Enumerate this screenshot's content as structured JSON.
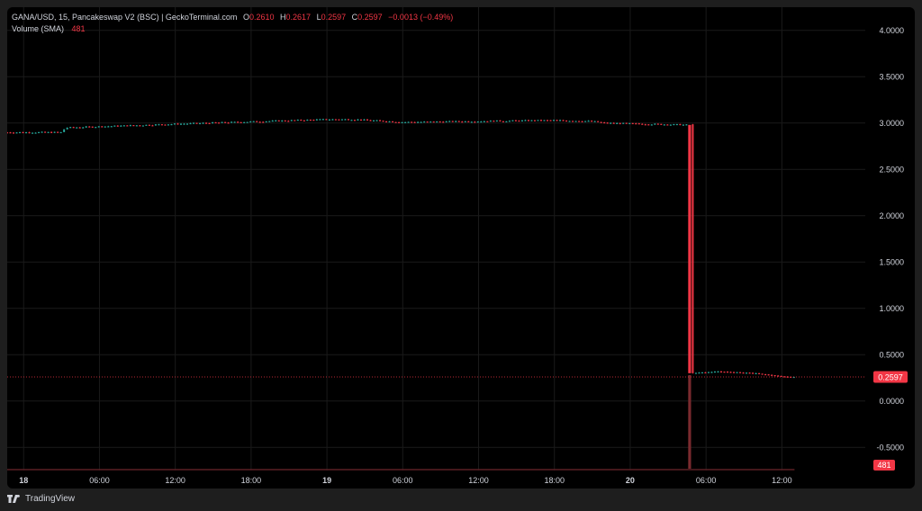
{
  "legend": {
    "title": "GANA/USD, 15, Pancakeswap V2 (BSC) | GeckoTerminal.com",
    "o_label": "O",
    "o_value": "0.2610",
    "h_label": "H",
    "h_value": "0.2617",
    "l_label": "L",
    "l_value": "0.2597",
    "c_label": "C",
    "c_value": "0.2597",
    "change": "−0.0013 (−0.49%)",
    "volume_label": "Volume (SMA)",
    "volume_value": "481"
  },
  "branding": {
    "text": "TradingView",
    "icon": "tradingview-logo-icon"
  },
  "colors": {
    "up": "#26a69a",
    "down": "#f23645",
    "background": "#000000",
    "grid": "#1a1a1a",
    "text": "#d1d4dc"
  },
  "chart_data": {
    "type": "candlestick",
    "ylim": [
      -0.75,
      4.25
    ],
    "y_ticks": [
      "4.0000",
      "3.5000",
      "3.0000",
      "2.5000",
      "2.0000",
      "1.5000",
      "1.0000",
      "0.5000",
      "0.0000",
      "-0.5000"
    ],
    "x_ticks": [
      "18",
      "06:00",
      "12:00",
      "18:00",
      "19",
      "06:00",
      "12:00",
      "18:00",
      "20",
      "06:00",
      "12:00"
    ],
    "x_tick_hours": [
      0,
      6,
      12,
      18,
      24,
      30,
      36,
      42,
      48,
      54,
      60
    ],
    "x_range_hours": [
      -1.3,
      66.6
    ],
    "last_price": {
      "label": "0.2597",
      "value": 0.2597
    },
    "volume_badge": "481",
    "price_path": [
      {
        "t": -1.3,
        "p": 2.9
      },
      {
        "t": 3.0,
        "p": 2.9
      },
      {
        "t": 3.3,
        "p": 2.95
      },
      {
        "t": 12.0,
        "p": 2.99
      },
      {
        "t": 24.0,
        "p": 3.04
      },
      {
        "t": 26.0,
        "p": 3.04
      },
      {
        "t": 30.0,
        "p": 3.01
      },
      {
        "t": 42.0,
        "p": 3.03
      },
      {
        "t": 45.0,
        "p": 3.02
      },
      {
        "t": 46.0,
        "p": 3.0
      },
      {
        "t": 52.7,
        "p": 2.98
      },
      {
        "t": 52.8,
        "p": 0.3
      },
      {
        "t": 55.0,
        "p": 0.32
      },
      {
        "t": 58.0,
        "p": 0.3
      },
      {
        "t": 59.0,
        "p": 0.28
      },
      {
        "t": 60.5,
        "p": 0.26
      },
      {
        "t": 61.0,
        "p": 0.2597
      }
    ],
    "crash": {
      "t": 52.7,
      "open": 2.98,
      "close": 0.3
    }
  }
}
